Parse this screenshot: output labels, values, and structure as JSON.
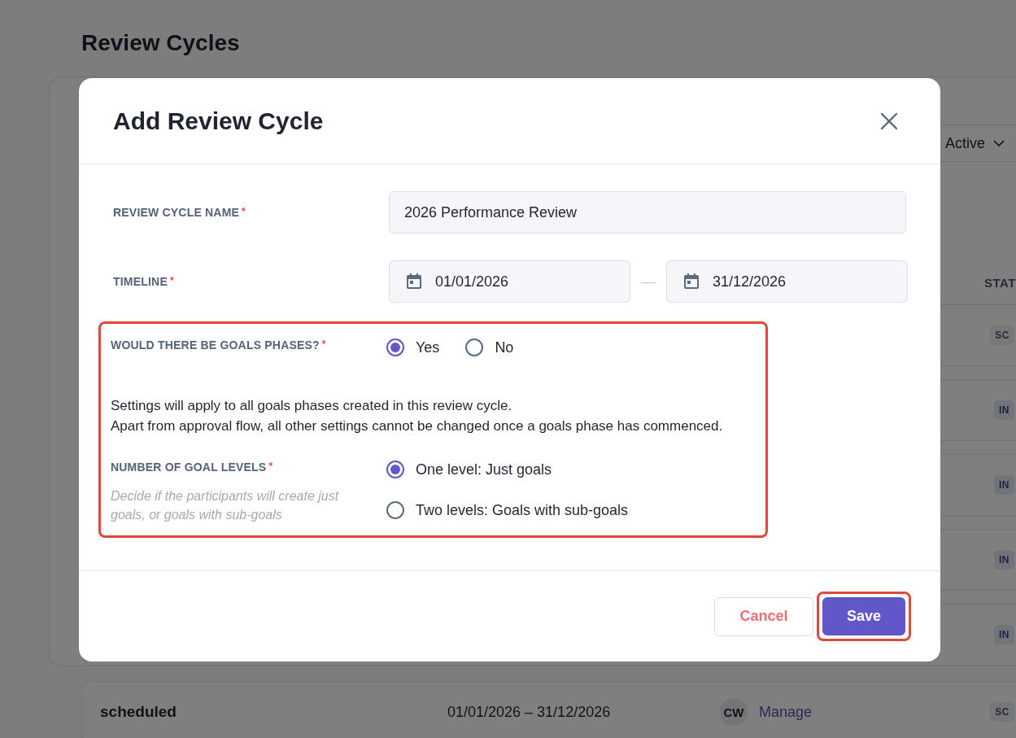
{
  "page": {
    "title": "Review Cycles"
  },
  "filter": {
    "value": "Active"
  },
  "table": {
    "column_header": "STAT",
    "rows": [
      {
        "status": "SC",
        "kind": "scheduled"
      },
      {
        "status": "IN",
        "kind": "progress"
      },
      {
        "status": "IN",
        "kind": "progress"
      },
      {
        "status": "IN",
        "kind": "progress"
      },
      {
        "status": "IN",
        "kind": "progress"
      }
    ]
  },
  "bottom_row": {
    "name": "scheduled",
    "dates": "01/01/2026 – 31/12/2026",
    "avatar": "CW",
    "link": "Manage",
    "status": "SC",
    "kind": "scheduled"
  },
  "dialog": {
    "title": "Add Review Cycle",
    "name_field": {
      "label": "REVIEW CYCLE NAME",
      "required_mark": "*",
      "value": "2026 Performance Review"
    },
    "timeline": {
      "label": "TIMELINE",
      "required_mark": "*",
      "start": "01/01/2026",
      "separator": "—",
      "end": "31/12/2026"
    },
    "goals_phases": {
      "label": "WOULD THERE BE GOALS PHASES?",
      "required_mark": "*",
      "options": [
        {
          "label": "Yes",
          "selected": true
        },
        {
          "label": "No",
          "selected": false
        }
      ]
    },
    "notice": [
      "Settings will apply to all goals phases created in this review cycle.",
      "Apart from approval flow, all other settings cannot be changed once a goals phase has commenced."
    ],
    "goal_levels": {
      "label": "NUMBER OF GOAL LEVELS",
      "required_mark": "*",
      "hint": "Decide if the participants will create just goals, or goals with sub-goals",
      "options": [
        {
          "label": "One level: Just goals",
          "selected": true
        },
        {
          "label": "Two levels: Goals with sub-goals",
          "selected": false
        }
      ]
    },
    "buttons": {
      "cancel": "Cancel",
      "save": "Save"
    }
  }
}
